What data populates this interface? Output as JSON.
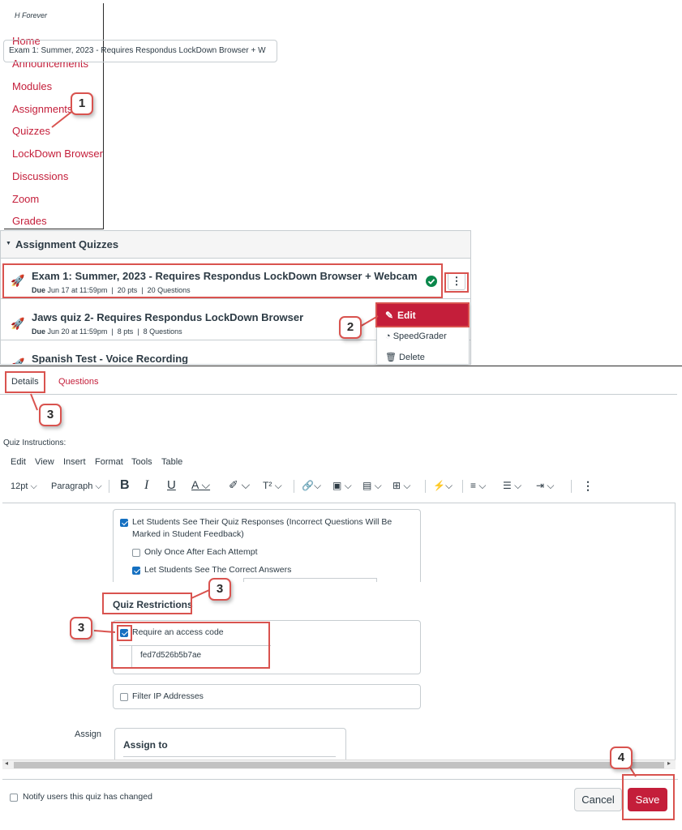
{
  "course_nav": {
    "course_name": "H Forever",
    "items": [
      {
        "label": "Home"
      },
      {
        "label": "Announcements"
      },
      {
        "label": "Modules"
      },
      {
        "label": "Assignments"
      },
      {
        "label": "Quizzes"
      },
      {
        "label": "LockDown Browser"
      },
      {
        "label": "Discussions"
      },
      {
        "label": "Zoom"
      },
      {
        "label": "Grades"
      }
    ]
  },
  "quiz_list": {
    "group_title": "Assignment Quizzes",
    "quizzes": [
      {
        "title": "Exam 1: Summer, 2023 - Requires Respondus LockDown Browser + Webcam",
        "due_label": "Due",
        "due": "Jun 17 at 11:59pm",
        "points": "20 pts",
        "questions": "20 Questions",
        "published": true
      },
      {
        "title": "Jaws quiz 2- Requires Respondus LockDown Browser",
        "due_label": "Due",
        "due": "Jun 20 at 11:59pm",
        "points": "8 pts",
        "questions": "8 Questions"
      },
      {
        "title": "Spanish Test - Voice Recording"
      }
    ],
    "menu": {
      "edit": "Edit",
      "speedgrader": "SpeedGrader",
      "delete": "Delete"
    }
  },
  "editor": {
    "tabs": {
      "details": "Details",
      "questions": "Questions"
    },
    "title_value": "Exam 1: Summer, 2023 - Requires Respondus LockDown Browser + W",
    "instructions_label": "Quiz Instructions:",
    "menubar": [
      "Edit",
      "View",
      "Insert",
      "Format",
      "Tools",
      "Table"
    ],
    "font_size": "12pt",
    "block_format": "Paragraph",
    "options": {
      "see_responses": "Let Students See Their Quiz Responses (Incorrect Questions Will Be",
      "see_responses_2": "Marked in Student Feedback)",
      "only_once": "Only Once After Each Attempt",
      "see_correct": "Let Students See The Correct Answers"
    },
    "restrictions_heading": "Quiz Restrictions",
    "require_access_code": "Require an access code",
    "access_code_value": "fed7d526b5b7ae",
    "filter_ip": "Filter IP Addresses",
    "assign_label": "Assign",
    "assign_to": "Assign to",
    "notify": "Notify users this quiz has changed",
    "cancel": "Cancel",
    "save": "Save"
  },
  "callouts": {
    "step1": "1",
    "step2": "2",
    "step3": "3",
    "step4": "4"
  },
  "colors": {
    "brand_red": "#c41e3a",
    "callout_red": "#d9534f",
    "check_blue": "#1570c1",
    "published_green": "#0b874b"
  }
}
